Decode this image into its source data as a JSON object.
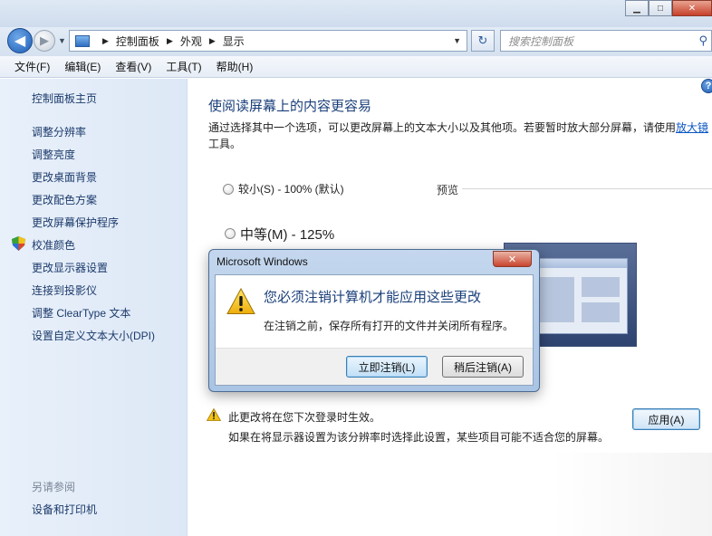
{
  "window": {
    "min_label": "▁",
    "max_label": "□",
    "close_label": "✕"
  },
  "address": {
    "back_glyph": "◀",
    "forward_glyph": "▶",
    "breadcrumb": [
      "控制面板",
      "外观",
      "显示"
    ],
    "refresh_glyph": "↻",
    "search_placeholder": "搜索控制面板",
    "search_glyph": "⚲"
  },
  "menubar": {
    "items": [
      "文件(F)",
      "编辑(E)",
      "查看(V)",
      "工具(T)",
      "帮助(H)"
    ]
  },
  "sidebar": {
    "home": "控制面板主页",
    "links": [
      "调整分辨率",
      "调整亮度",
      "更改桌面背景",
      "更改配色方案",
      "更改屏幕保护程序",
      "校准颜色",
      "更改显示器设置",
      "连接到投影仪",
      "调整 ClearType 文本",
      "设置自定义文本大小(DPI)"
    ],
    "see_also_header": "另请参阅",
    "see_also": [
      "设备和打印机"
    ]
  },
  "main": {
    "help_glyph": "?",
    "title": "使阅读屏幕上的内容更容易",
    "desc_before": "通过选择其中一个选项，可以更改屏幕上的文本大小以及其他项。若要暂时放大部分屏幕，请使用",
    "desc_link": "放大镜",
    "desc_after": "工具。",
    "option_small": "较小(S) - 100% (默认)",
    "option_medium": "中等(M) - 125%",
    "preview_label": "预览",
    "notice1": "此更改将在您下次登录时生效。",
    "notice2": "如果在将显示器设置为该分辨率时选择此设置，某些项目可能不适合您的屏幕。",
    "apply_label": "应用(A)"
  },
  "dialog": {
    "title": "Microsoft Windows",
    "close_glyph": "✕",
    "heading": "您必须注销计算机才能应用这些更改",
    "message": "在注销之前，保存所有打开的文件并关闭所有程序。",
    "btn_logoff_now": "立即注销(L)",
    "btn_logoff_later": "稍后注销(A)"
  },
  "colors": {
    "link": "#1c3a6b",
    "title_blue": "#1a3f7a",
    "warning_yellow": "#f2c314"
  }
}
